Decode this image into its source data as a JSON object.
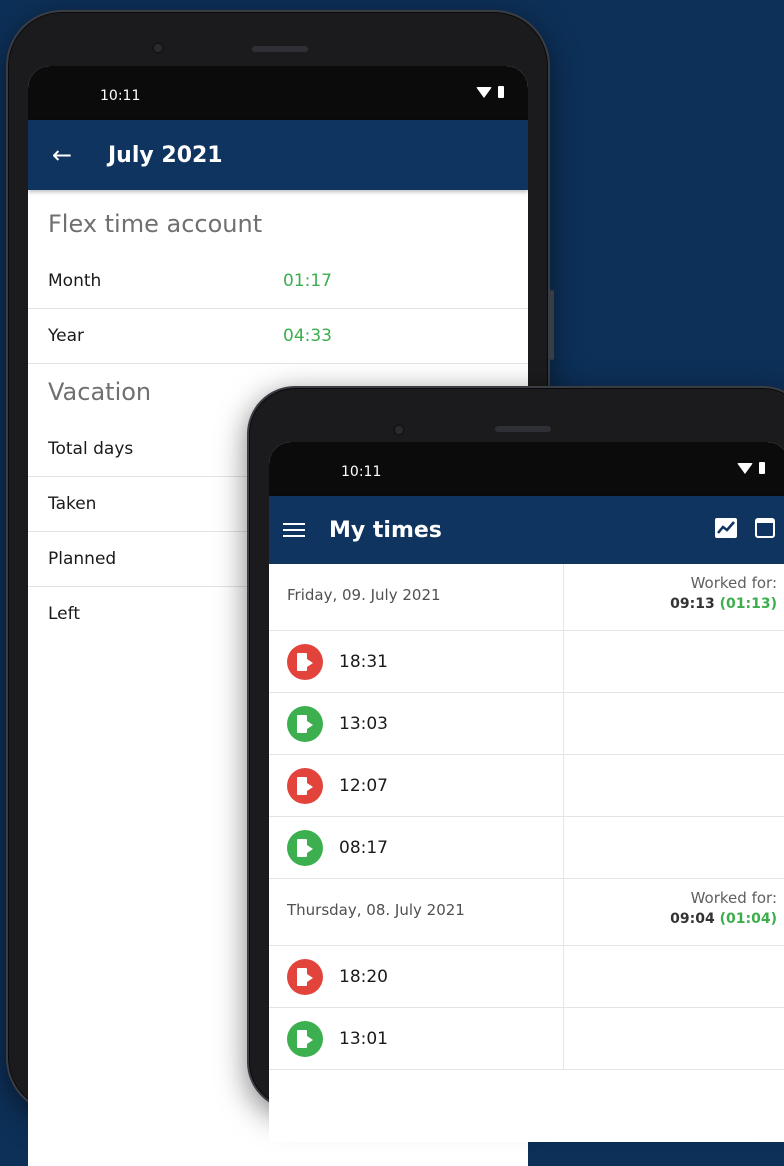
{
  "phone1": {
    "status_time": "10:11",
    "appbar_title": "July 2021",
    "flex_section_title": "Flex time account",
    "flex_rows": [
      {
        "label": "Month",
        "value": "01:17"
      },
      {
        "label": "Year",
        "value": "04:33"
      }
    ],
    "vacation_section_title": "Vacation",
    "vacation_rows": [
      {
        "label": "Total days"
      },
      {
        "label": "Taken"
      },
      {
        "label": "Planned"
      },
      {
        "label": "Left"
      }
    ]
  },
  "phone2": {
    "status_time": "10:11",
    "appbar_title": "My times",
    "days": [
      {
        "date": "Friday, 09. July 2021",
        "worked_label": "Worked for:",
        "worked_total": "09:13",
        "worked_flex": "(01:13)",
        "entries": [
          {
            "time": "18:31",
            "type": "out"
          },
          {
            "time": "13:03",
            "type": "in"
          },
          {
            "time": "12:07",
            "type": "out"
          },
          {
            "time": "08:17",
            "type": "in"
          }
        ]
      },
      {
        "date": "Thursday, 08. July 2021",
        "worked_label": "Worked for:",
        "worked_total": "09:04",
        "worked_flex": "(01:04)",
        "entries": [
          {
            "time": "18:20",
            "type": "out"
          },
          {
            "time": "13:01",
            "type": "in"
          }
        ]
      }
    ]
  },
  "colors": {
    "background": "#0d3058",
    "appbar": "#0f3460",
    "positive_green": "#3cae4c",
    "clock_out_red": "#e2443c",
    "clock_in_green": "#3caf4e"
  },
  "icons": {
    "back": "arrow-left-icon",
    "menu": "menu-icon",
    "statistics": "chart-icon",
    "calendar": "calendar-icon",
    "clock_out": "door-exit-icon",
    "clock_in": "door-enter-icon",
    "wifi": "wifi-icon",
    "battery": "battery-icon"
  }
}
